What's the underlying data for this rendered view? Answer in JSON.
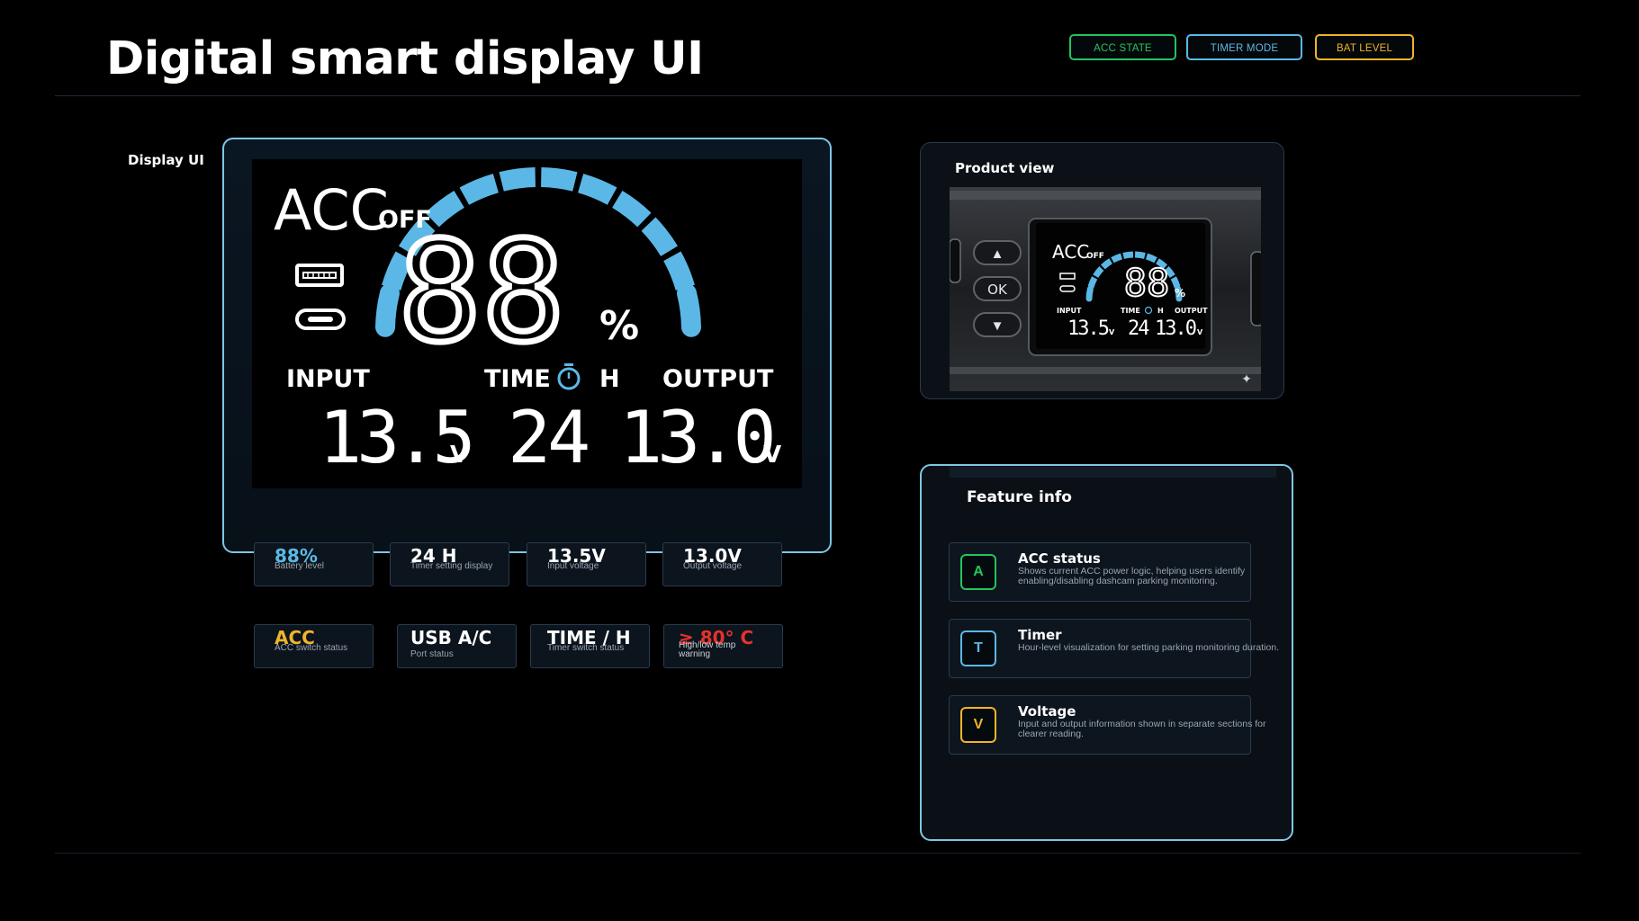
{
  "header": {
    "title": "Digital smart display UI",
    "chips": [
      {
        "label": "ACC STATE",
        "color": "#22c55e"
      },
      {
        "label": "TIMER MODE",
        "color": "#5bb8e6"
      },
      {
        "label": "BAT LEVEL",
        "color": "#f0b429"
      }
    ]
  },
  "display_section": {
    "label": "Display UI",
    "lcd": {
      "acc_text": "ACC",
      "off_text": "OFF",
      "battery_digits": "88",
      "percent_sign": "%",
      "input_label": "INPUT",
      "time_label": "TIME",
      "hour_unit": "H",
      "output_label": "OUTPUT",
      "input_value": "13.5",
      "input_unit": "V",
      "time_value": "24",
      "output_value": "13.0",
      "output_unit": "V",
      "arc_segments": 12,
      "arc_color": "#5bb8e6",
      "icons": [
        "usb-a-port-icon",
        "usb-c-port-icon",
        "timer-icon"
      ]
    },
    "tiles_row1": [
      {
        "value": "88%",
        "sub": "Battery level",
        "color": "#5bb8e6"
      },
      {
        "value": "24 H",
        "sub": "Timer setting display",
        "color": "#ffffff"
      },
      {
        "value": "13.5V",
        "sub": "Input voltage",
        "color": "#ffffff"
      },
      {
        "value": "13.0V",
        "sub": "Output voltage",
        "color": "#ffffff"
      }
    ],
    "tiles_row2": [
      {
        "value": "ACC",
        "sub": "ACC switch status",
        "color": "#f0b429"
      },
      {
        "value": "USB A/C",
        "sub": "Port status",
        "color": "#ffffff"
      },
      {
        "value": "TIME  / H",
        "sub": "Timer switch status",
        "color": "#ffffff"
      },
      {
        "value": "≥ 80° C",
        "sub": "High/low temp warning",
        "color": "#e5322d"
      }
    ]
  },
  "product_view": {
    "label": "Product view",
    "buttons": {
      "up": "▲",
      "ok": "OK",
      "down": "▼"
    },
    "mini": {
      "acc": "ACC",
      "off": "OFF",
      "digits": "88",
      "percent": "%",
      "input": "INPUT",
      "time": "TIME",
      "hour": "H",
      "output": "OUTPUT",
      "input_value": "13.5",
      "input_unit": "V",
      "time_value": "24",
      "output_value": "13.0",
      "output_unit": "V"
    }
  },
  "feature_info": {
    "label": "Feature info",
    "items": [
      {
        "badge": "A",
        "title": "ACC status",
        "desc": "Shows current ACC power logic, helping users identify enabling/disabling dashcam parking monitoring.",
        "color": "#22c55e"
      },
      {
        "badge": "T",
        "title": "Timer",
        "desc": "Hour-level visualization for setting parking monitoring duration.",
        "color": "#5bb8e6"
      },
      {
        "badge": "V",
        "title": "Voltage",
        "desc": "Input and output information shown in separate sections for clearer reading.",
        "color": "#f0b429"
      }
    ]
  }
}
